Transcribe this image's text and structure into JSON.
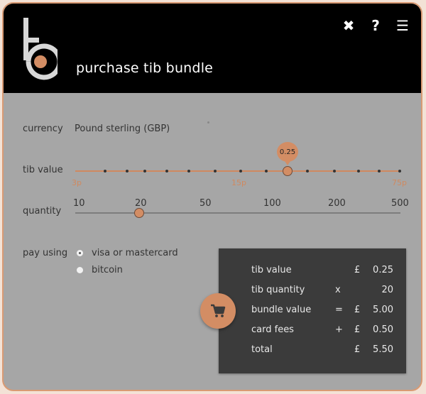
{
  "header": {
    "title": "purchase tib bundle",
    "icons": [
      "close-icon",
      "help-icon",
      "menu-icon"
    ],
    "close_glyph": "✖",
    "help_glyph": "?",
    "menu_glyph": "☰"
  },
  "currency": {
    "label": "currency",
    "value": "Pound sterling (GBP)"
  },
  "tib_value": {
    "label": "tib value",
    "selected": "0.25",
    "ticks": [
      "3p",
      "15p",
      "75p"
    ]
  },
  "quantity": {
    "label": "quantity",
    "ticks": [
      "10",
      "20",
      "50",
      "100",
      "200",
      "500"
    ],
    "selected": "20"
  },
  "pay": {
    "label": "pay using",
    "options": [
      "visa or mastercard",
      "bitcoin"
    ],
    "selected": "visa or mastercard"
  },
  "summary": {
    "rows": [
      {
        "label": "tib value",
        "op": "",
        "cur": "£",
        "amount": "0.25"
      },
      {
        "label": "tib quantity",
        "op": "x",
        "cur": "",
        "amount": "20"
      },
      {
        "label": "bundle value",
        "op": "=",
        "cur": "£",
        "amount": "5.00"
      },
      {
        "label": "card fees",
        "op": "+",
        "cur": "£",
        "amount": "0.50"
      },
      {
        "label": "total",
        "op": "",
        "cur": "£",
        "amount": "5.50"
      }
    ]
  },
  "colors": {
    "accent": "#d38d64",
    "header_bg": "#000000",
    "panel_bg": "#a6a6a6",
    "summary_bg": "#3b3b3b"
  }
}
